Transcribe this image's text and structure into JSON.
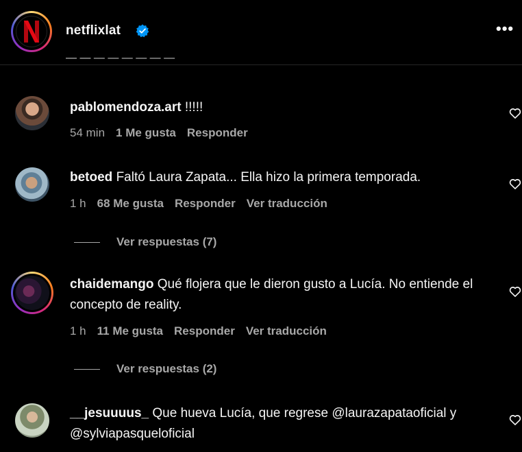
{
  "header": {
    "username": "netflixlat",
    "logo_letter": "N",
    "more_label": "•••",
    "cut_text": "— — — — — — — —"
  },
  "comments": [
    {
      "username": "pablomendoza.art",
      "text": "!!!!!",
      "time": "54 min",
      "likes": "1 Me gusta",
      "reply": "Responder"
    },
    {
      "username": "betoed",
      "text": "Faltó Laura Zapata... Ella hizo la primera temporada.",
      "time": "1 h",
      "likes": "68 Me gusta",
      "reply": "Responder",
      "translate": "Ver traducción",
      "view_replies": "Ver respuestas (7)"
    },
    {
      "username": "chaidemango",
      "text": "Qué flojera que le dieron gusto a Lucía. No entiende el concepto de reality.",
      "time": "1 h",
      "likes": "11 Me gusta",
      "reply": "Responder",
      "translate": "Ver traducción",
      "view_replies": "Ver respuestas (2)"
    },
    {
      "username": "__jesuuuus_",
      "text": "Que hueva Lucía, que regrese @laurazapataoficial y @sylviapasqueloficial"
    }
  ],
  "colors": {
    "background": "#000000",
    "text": "#f5f5f5",
    "muted": "#a8a8a8",
    "verified": "#0095f6",
    "netflix_red": "#e50914"
  },
  "icons": [
    "verified-badge-icon",
    "heart-icon",
    "more-icon"
  ]
}
